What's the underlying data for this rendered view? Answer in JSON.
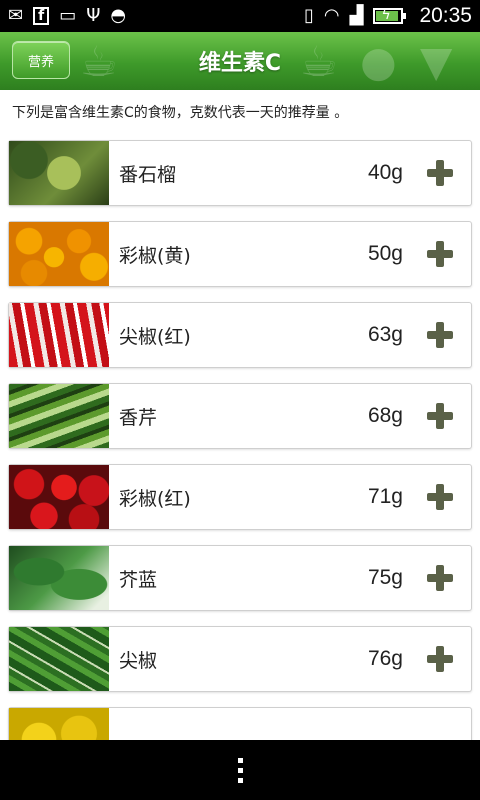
{
  "status_bar": {
    "time": "20:35",
    "left_icons": [
      "mail-icon",
      "facebook-icon",
      "message-icon",
      "usb-icon",
      "android-icon"
    ],
    "right_icons": [
      "vibrate-icon",
      "wifi-icon",
      "signal-icon",
      "battery-icon"
    ]
  },
  "header": {
    "back_label": "营养",
    "title": "维生素C",
    "colors": {
      "green_light": "#6cc24a",
      "green_dark": "#2e7f1f"
    }
  },
  "intro_text": "下列是富含维生素C的食物，克数代表一天的推荐量 。",
  "items": [
    {
      "name": "番石榴",
      "amount": "40g",
      "thumb": "guava"
    },
    {
      "name": "彩椒(黄)",
      "amount": "50g",
      "thumb": "yellow-pepper"
    },
    {
      "name": "尖椒(红)",
      "amount": "63g",
      "thumb": "red-chili"
    },
    {
      "name": "香芹",
      "amount": "68g",
      "thumb": "celery"
    },
    {
      "name": "彩椒(红)",
      "amount": "71g",
      "thumb": "red-pepper"
    },
    {
      "name": "芥蓝",
      "amount": "75g",
      "thumb": "kale"
    },
    {
      "name": "尖椒",
      "amount": "76g",
      "thumb": "green-chili"
    }
  ]
}
